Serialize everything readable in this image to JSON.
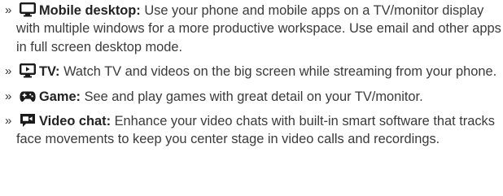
{
  "bullet_glyph": "»",
  "items": [
    {
      "icon": "monitor-icon",
      "title": "Mobile desktop:",
      "description": "Use your phone and mobile apps on a TV/monitor display with multiple windows for a more productive workspace. Use email and other apps in full screen desktop mode."
    },
    {
      "icon": "tv-play-icon",
      "title": "TV:",
      "description": "Watch TV and videos on the big screen while streaming from your phone."
    },
    {
      "icon": "gamepad-icon",
      "title": "Game:",
      "description": "See and play games with great detail on your TV/monitor."
    },
    {
      "icon": "video-chat-icon",
      "title": "Video chat:",
      "description": "Enhance your video chats with built-in smart software that tracks face movements to keep you center stage in video calls and recordings."
    }
  ]
}
